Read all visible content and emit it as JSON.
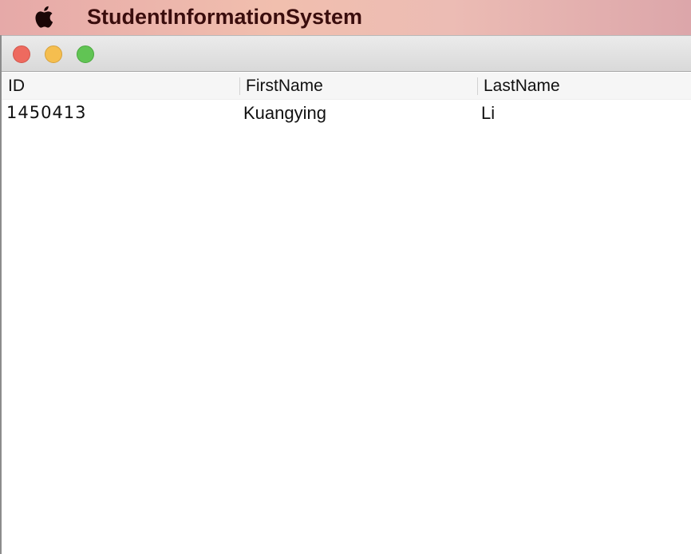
{
  "menubar": {
    "app_title": "StudentInformationSystem",
    "apple_icon": "apple-logo-icon"
  },
  "window": {
    "traffic_lights": {
      "close": "close-icon",
      "minimize": "minimize-icon",
      "zoom": "zoom-icon"
    },
    "colors": {
      "close": "#ee6a5f",
      "minimize": "#f5be4f",
      "zoom": "#61c454"
    }
  },
  "table": {
    "columns": [
      "ID",
      "FirstName",
      "LastName"
    ],
    "rows": [
      [
        "1450413",
        "Kuangying",
        "Li"
      ]
    ]
  }
}
